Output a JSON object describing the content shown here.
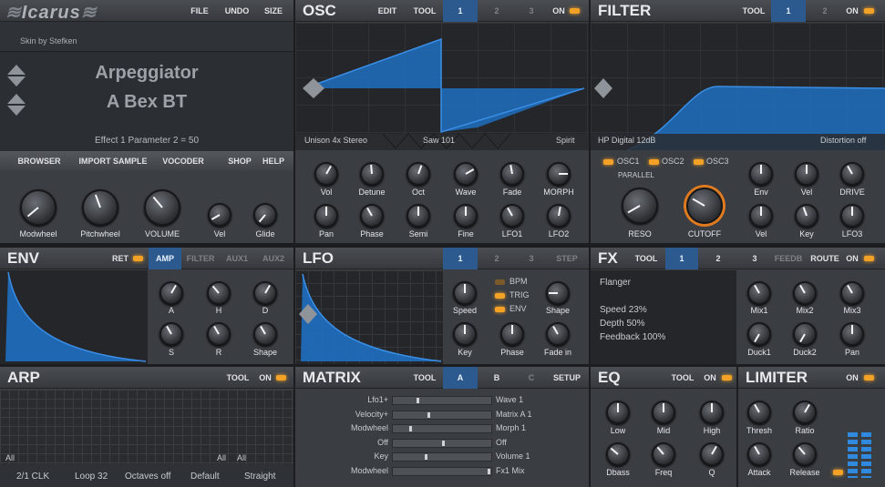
{
  "top": {
    "logo": "Icarus",
    "file": "FILE",
    "undo": "UNDO",
    "size": "SIZE",
    "skin": "Skin by Stefken",
    "preset_category": "Arpeggiator",
    "preset_name": "A Bex BT",
    "param_readout": "Effect 1 Parameter 2 = 50"
  },
  "nav": {
    "browser": "BROWSER",
    "import": "IMPORT SAMPLE",
    "vocoder": "VOCODER",
    "shop": "SHOP",
    "help": "HELP"
  },
  "master_knobs": [
    "Modwheel",
    "Pitchwheel",
    "VOLUME",
    "Vel",
    "Glide"
  ],
  "osc": {
    "title": "OSC",
    "edit": "EDIT",
    "tool": "TOOL",
    "tabs": [
      "1",
      "2",
      "3"
    ],
    "on": "ON",
    "unison": "Unison 4x Stereo",
    "wave": "Saw 101",
    "spirit": "Spirit",
    "knobs_row1": [
      "Vol",
      "Detune",
      "Oct",
      "Wave",
      "Fade",
      "MORPH"
    ],
    "knobs_row2": [
      "Pan",
      "Phase",
      "Semi",
      "Fine",
      "LFO1",
      "LFO2"
    ]
  },
  "filter": {
    "title": "FILTER",
    "tool": "TOOL",
    "tabs": [
      "1",
      "2"
    ],
    "on": "ON",
    "type": "HP Digital 12dB",
    "distortion": "Distortion off",
    "osc1": "OSC1",
    "osc2": "OSC2",
    "osc3": "OSC3",
    "parallel": "PARALLEL",
    "reso": "RESO",
    "cutoff": "CUTOFF",
    "knobs_row1": [
      "Env",
      "Vel",
      "DRIVE"
    ],
    "knobs_row2": [
      "Vel",
      "Key",
      "LFO3"
    ]
  },
  "env": {
    "title": "ENV",
    "ret": "RET",
    "tabs": [
      "AMP",
      "FILTER",
      "AUX1",
      "AUX2"
    ],
    "knobs": [
      "A",
      "H",
      "D",
      "S",
      "R",
      "Shape"
    ]
  },
  "lfo": {
    "title": "LFO",
    "tabs": [
      "1",
      "2",
      "3",
      "STEP"
    ],
    "bpm": "BPM",
    "trig": "TRIG",
    "env": "ENV",
    "knobs": [
      "Speed",
      "Shape",
      "Key",
      "Phase",
      "Fade in"
    ]
  },
  "fx": {
    "title": "FX",
    "tool": "TOOL",
    "tabs": [
      "1",
      "2",
      "3"
    ],
    "feedb": "FEEDB",
    "route": "ROUTE",
    "on": "ON",
    "name": "Flanger",
    "speed": "Speed 23%",
    "depth": "Depth 50%",
    "feedback": "Feedback 100%",
    "knobs": [
      "Mix1",
      "Mix2",
      "Mix3",
      "Duck1",
      "Duck2",
      "Pan"
    ]
  },
  "arp": {
    "title": "ARP",
    "tool": "TOOL",
    "on": "ON",
    "clk": "2/1 CLK",
    "loop": "Loop 32",
    "octaves": "Octaves off",
    "default": "Default",
    "straight": "Straight",
    "all_labels": [
      "All",
      "All",
      "All"
    ]
  },
  "matrix": {
    "title": "MATRIX",
    "tool": "TOOL",
    "tabs": [
      "A",
      "B",
      "C"
    ],
    "setup": "SETUP",
    "sources": [
      "Lfo1+",
      "Velocity+",
      "Modwheel",
      "Off",
      "Key",
      "Modwheel"
    ],
    "targets": [
      "Wave 1",
      "Matrix A 1",
      "Morph 1",
      "Off",
      "Volume 1",
      "Fx1 Mix"
    ]
  },
  "eq": {
    "title": "EQ",
    "tool": "TOOL",
    "on": "ON",
    "knobs": [
      "Low",
      "Mid",
      "High",
      "Dbass",
      "Freq",
      "Q"
    ]
  },
  "limiter": {
    "title": "LIMITER",
    "on": "ON",
    "knobs": [
      "Thresh",
      "Ratio",
      "Attack",
      "Release"
    ]
  },
  "colors": {
    "accent": "#2c5a8e",
    "wave": "#1f6fc0",
    "led": "#f3a227"
  }
}
